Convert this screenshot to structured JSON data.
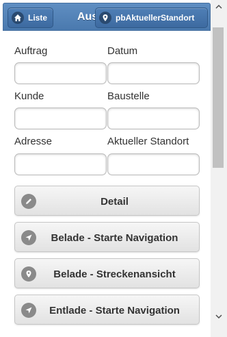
{
  "header": {
    "title": "Aus",
    "liste_label": "Liste",
    "standort_label": "pbAktuellerStandort"
  },
  "form": {
    "auftrag_label": "Auftrag",
    "datum_label": "Datum",
    "kunde_label": "Kunde",
    "baustelle_label": "Baustelle",
    "adresse_label": "Adresse",
    "standort_label": "Aktueller Standort",
    "auftrag_value": "",
    "datum_value": "",
    "kunde_value": "",
    "baustelle_value": "",
    "adresse_value": "",
    "standort_value": ""
  },
  "actions": {
    "detail": "Detail",
    "belade_nav": "Belade - Starte Navigation",
    "belade_strecke": "Belade - Streckenansicht",
    "entlade_nav": "Entlade - Starte Navigation"
  },
  "icons": {
    "liste": "home-icon",
    "standort": "map-marker-icon",
    "detail": "pencil-icon",
    "belade_nav": "navigation-icon",
    "belade_strecke": "map-marker-icon",
    "entlade_nav": "navigation-icon"
  },
  "colors": {
    "header": "#5585bb",
    "button_face": "#ececec",
    "icon_disc": "#8a8a8a"
  }
}
